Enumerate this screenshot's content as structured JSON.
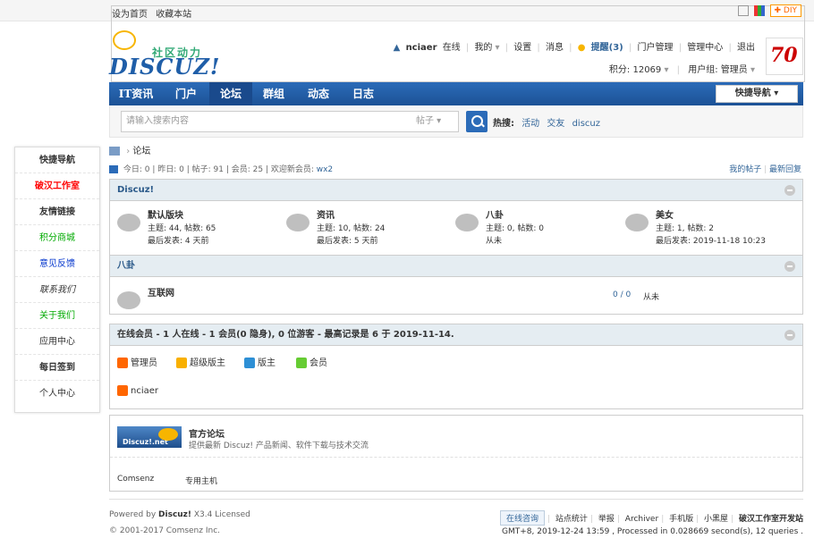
{
  "topbar": {
    "set_home": "设为首页",
    "favorite": "收藏本站",
    "diy": "DIY"
  },
  "logo": {
    "cn": "社区动力",
    "en": "DISCUZ!"
  },
  "user": {
    "name": "nciaer",
    "status": "在线",
    "my": "我的",
    "settings": "设置",
    "messages": "消息",
    "remind": "提醒(3)",
    "portal_admin": "门户管理",
    "admin_center": "管理中心",
    "logout": "退出",
    "points_label": "积分:",
    "points": "12069",
    "group_label": "用户组:",
    "group": "管理员"
  },
  "nav": {
    "items": [
      "IT资讯",
      "门户",
      "论坛",
      "群组",
      "动态",
      "日志"
    ],
    "quick": "快捷导航"
  },
  "search": {
    "placeholder": "请输入搜索内容",
    "type": "帖子",
    "hot_label": "热搜:",
    "hot": [
      "活动",
      "交友",
      "discuz"
    ]
  },
  "sidebar": {
    "items": [
      {
        "label": "快捷导航",
        "color": "#333333"
      },
      {
        "label": "破汉工作室",
        "color": "#ff0000"
      },
      {
        "label": "友情链接",
        "color": "#333333"
      },
      {
        "label": "积分商城",
        "color": "#00aa00"
      },
      {
        "label": "意见反馈",
        "color": "#0033cc"
      },
      {
        "label": "联系我们",
        "color": "#333333"
      },
      {
        "label": "关于我们",
        "color": "#00aa00"
      },
      {
        "label": "应用中心",
        "color": "#333333"
      },
      {
        "label": "每日签到",
        "color": "#333333"
      },
      {
        "label": "个人中心",
        "color": "#333333"
      }
    ]
  },
  "breadcrumb": {
    "current": "论坛"
  },
  "stats": {
    "text": "今日: 0 | 昨日: 0 | 帖子: 91 | 会员: 25 | 欢迎新会员: ",
    "new_member": "wx2",
    "my_posts": "我的帖子",
    "latest": "最新回复"
  },
  "categories": [
    {
      "name": "Discuz!",
      "forums": [
        {
          "title": "默认版块",
          "line1": "主题: 44, 帖数: 65",
          "line2": "最后发表: 4 天前"
        },
        {
          "title": "资讯",
          "line1": "主题: 10, 帖数: 24",
          "line2": "最后发表: 5 天前"
        },
        {
          "title": "八卦",
          "line1": "主题: 0, 帖数: 0",
          "line2": "从未"
        },
        {
          "title": "美女",
          "line1": "主题: 1, 帖数: 2",
          "line2": "最后发表: 2019-11-18 10:23"
        }
      ]
    },
    {
      "name": "八卦",
      "forums": [
        {
          "title": "互联网",
          "count": "0 / 0",
          "last": "从未"
        }
      ]
    }
  ],
  "online": {
    "header": "在线会员 - 1 人在线 - 1 会员(0 隐身), 0 位游客 - 最高记录是 6 于 2019-11-14.",
    "roles": [
      "管理员",
      "超级版主",
      "版主",
      "会员"
    ],
    "members": [
      "nciaer"
    ]
  },
  "friendlinks": {
    "logo_text": "Discuz!.net",
    "title": "官方论坛",
    "desc": "提供最新 Discuz! 产品新闻、软件下载与技术交流",
    "text_links": [
      "Comsenz",
      "专用主机"
    ]
  },
  "footer": {
    "powered_prefix": "Powered by ",
    "powered_brand": "Discuz!",
    "powered_suffix": " X3.4 Licensed",
    "copyright": "© 2001-2017 Comsenz Inc.",
    "links": [
      "在线咨询",
      "站点统计",
      "举报",
      "Archiver",
      "手机版",
      "小黑屋",
      "破汉工作室开发站"
    ],
    "info": "GMT+8, 2019-12-24 13:59 , Processed in 0.028669 second(s), 12 queries ."
  }
}
